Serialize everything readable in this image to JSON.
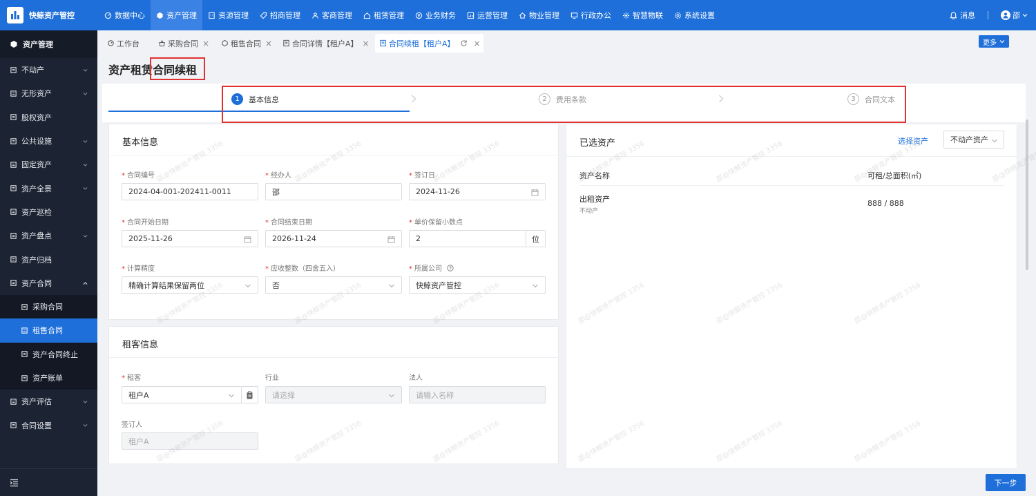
{
  "app": {
    "title": "快鲸资产管控"
  },
  "topnav": [
    {
      "label": "数据中心",
      "icon": "dashboard-icon"
    },
    {
      "label": "资产管理",
      "icon": "cube-icon",
      "active": true
    },
    {
      "label": "资源管理",
      "icon": "building-icon"
    },
    {
      "label": "招商管理",
      "icon": "tag-icon"
    },
    {
      "label": "客商管理",
      "icon": "users-icon"
    },
    {
      "label": "租赁管理",
      "icon": "house-icon"
    },
    {
      "label": "业务财务",
      "icon": "yen-icon"
    },
    {
      "label": "运营管理",
      "icon": "chart-icon"
    },
    {
      "label": "物业管理",
      "icon": "home-icon"
    },
    {
      "label": "行政办公",
      "icon": "monitor-icon"
    },
    {
      "label": "智慧物联",
      "icon": "iot-icon"
    },
    {
      "label": "系统设置",
      "icon": "gear-icon"
    }
  ],
  "topright": {
    "messages": "消息",
    "user": "邵"
  },
  "sidebar": {
    "header": "资产管理",
    "items": [
      {
        "label": "不动产",
        "chevron": true
      },
      {
        "label": "无形资产",
        "chevron": true
      },
      {
        "label": "股权资产",
        "chevron": false
      },
      {
        "label": "公共设施",
        "chevron": true
      },
      {
        "label": "固定资产",
        "chevron": true
      },
      {
        "label": "资产全景",
        "chevron": true
      },
      {
        "label": "资产巡检",
        "chevron": false
      },
      {
        "label": "资产盘点",
        "chevron": true
      },
      {
        "label": "资产归档",
        "chevron": false
      },
      {
        "label": "资产合同",
        "chevron": true,
        "expanded": true
      }
    ],
    "subitems": [
      {
        "label": "采购合同"
      },
      {
        "label": "租售合同",
        "active": true
      },
      {
        "label": "资产合同终止"
      },
      {
        "label": "资产账单"
      }
    ],
    "items_after": [
      {
        "label": "资产评估",
        "chevron": true
      },
      {
        "label": "合同设置",
        "chevron": true
      }
    ]
  },
  "tabs": [
    {
      "label": "工作台"
    },
    {
      "label": "采购合同"
    },
    {
      "label": "租售合同"
    },
    {
      "label": "合同详情【租户A】"
    },
    {
      "label": "合同续租【租户A】",
      "active": true
    }
  ],
  "more_label": "更多",
  "page": {
    "title": "资产租赁合同续租"
  },
  "steps": [
    {
      "num": "1",
      "label": "基本信息",
      "active": true
    },
    {
      "num": "2",
      "label": "费用条款"
    },
    {
      "num": "3",
      "label": "合同文本"
    }
  ],
  "basic": {
    "title": "基本信息",
    "contract_no": {
      "label": "合同编号",
      "value": "2024-04-001-202411-0011"
    },
    "handler": {
      "label": "经办人",
      "value": "邵"
    },
    "sign_date": {
      "label": "签订日",
      "value": "2024-11-26"
    },
    "start_date": {
      "label": "合同开始日期",
      "value": "2025-11-26"
    },
    "end_date": {
      "label": "合同结束日期",
      "value": "2026-11-24"
    },
    "decimals": {
      "label": "单价保留小数点",
      "value": "2",
      "unit": "位"
    },
    "precision": {
      "label": "计算精度",
      "value": "精确计算结果保留两位"
    },
    "rounding": {
      "label": "应收整数（四舍五入）",
      "value": "否"
    },
    "company": {
      "label": "所属公司",
      "value": "快鲸资产管控"
    }
  },
  "tenant": {
    "title": "租客信息",
    "tenant": {
      "label": "租客",
      "value": "租户A"
    },
    "industry": {
      "label": "行业",
      "placeholder": "请选择"
    },
    "legal": {
      "label": "法人",
      "placeholder": "请输入名称"
    },
    "signer": {
      "label": "签订人",
      "value": "租户A"
    }
  },
  "assets": {
    "title": "已选资产",
    "select_link": "选择资产",
    "type_select": "不动产资产",
    "columns": [
      "资产名称",
      "可租/总面积(㎡)"
    ],
    "rows": [
      {
        "name": "出租资产",
        "sub": "不动产",
        "area": "888 / 888"
      }
    ]
  },
  "watermark": "邵@快鲸资产管控 3356",
  "next_label": "下一步"
}
